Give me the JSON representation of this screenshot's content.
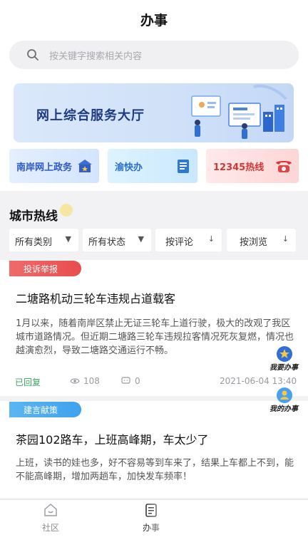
{
  "header": {
    "title": "办事"
  },
  "search": {
    "placeholder": "按关键字搜索相关内容",
    "icon": "search-icon"
  },
  "banner": {
    "title": "网上综合服务大厅"
  },
  "quick_links": [
    {
      "label": "南岸网上政务",
      "icon": "government-building-icon",
      "color": "#2a58c8"
    },
    {
      "label": "渝快办",
      "icon": "document-icon",
      "color": "#2a6fd0"
    },
    {
      "label": "12345热线",
      "icon": "telephone-icon",
      "color": "#d23838"
    }
  ],
  "section": {
    "title": "城市热线"
  },
  "filters": [
    {
      "label": "所有类别",
      "arrow": "▼"
    },
    {
      "label": "所有状态",
      "arrow": "▼"
    },
    {
      "label": "按评论",
      "arrow": "↓"
    },
    {
      "label": "按浏览",
      "arrow": "↓"
    }
  ],
  "posts": [
    {
      "tag": "投诉举报",
      "title": "二塘路机动三轮车违规占道载客",
      "body": "1月以来，随着南岸区禁止无证三轮车上道行驶，极大的改观了我区城市道路情况。但近期二塘路三轮车违规拉客情况死灰复燃，情况也越演愈烈，导致二塘路交通运行不畅。",
      "status": "已回复",
      "views": "108",
      "comments": "0",
      "date": "2021-06-04 13:40"
    },
    {
      "tag": "建言献策",
      "title": "茶园102路车，上班高峰期，车太少了",
      "body": "上班，读书的娃也多，好不容易等到车来了，结果上车都上不到，能不能高峰期，增加两趟车，加快发车频率！"
    }
  ],
  "floating": [
    {
      "label": "我要办事",
      "icon": "star-icon"
    },
    {
      "label": "我的办事",
      "icon": "user-icon"
    }
  ],
  "tabbar": [
    {
      "label": "社区",
      "icon": "home-icon"
    },
    {
      "label": "办事",
      "icon": "clipboard-icon"
    },
    {
      "label": "",
      "icon": ""
    }
  ]
}
